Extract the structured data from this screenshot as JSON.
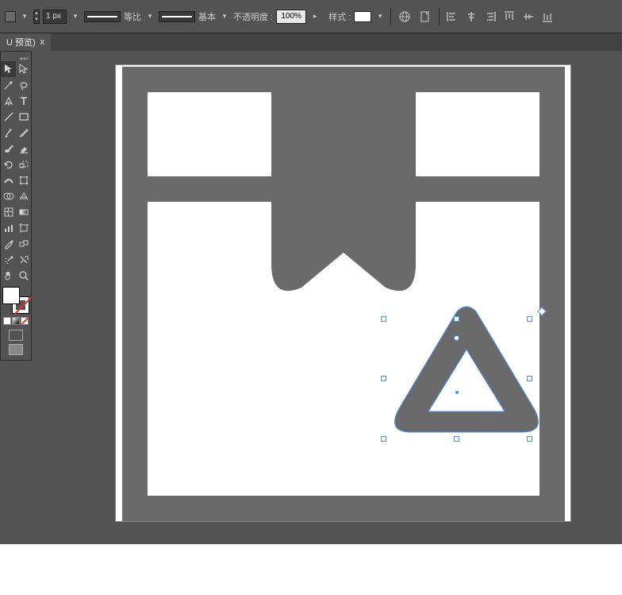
{
  "stroke_width": "1 px",
  "profile_label": "等比",
  "brush_label": "基本",
  "opacity_label": "不透明度 :",
  "opacity_value": "100%",
  "style_label": "样式 :",
  "tab": {
    "name": "U 预览)",
    "close": "x"
  },
  "icons": {
    "globe": "globe-icon",
    "document": "document-icon"
  },
  "colors": {
    "shape": "#6a6a6a",
    "selection": "#4a90ff"
  }
}
